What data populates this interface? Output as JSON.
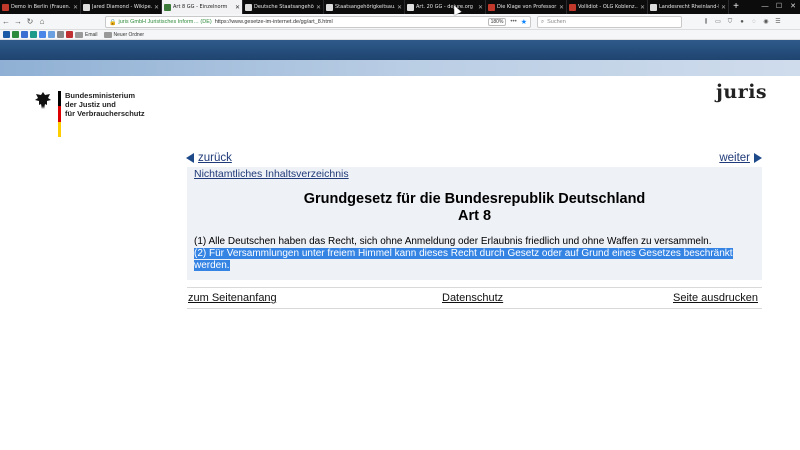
{
  "browser": {
    "tabs": [
      {
        "label": "Demo in Berlin (Frauen…",
        "active": false,
        "icon": "red-icon"
      },
      {
        "label": "Jared Diamond - Wikipe…",
        "active": false,
        "icon": "wikipedia-icon"
      },
      {
        "label": "Art 8 GG - Einzelnorm",
        "active": true,
        "icon": "juris-icon"
      },
      {
        "label": "Deutsche Staatsangehör…",
        "active": false,
        "icon": "wikipedia-icon"
      },
      {
        "label": "Staatsangehörigkeitsau…",
        "active": false,
        "icon": "wikipedia-icon"
      },
      {
        "label": "Art. 20 GG - dejure.org",
        "active": false,
        "icon": "dejure-icon"
      },
      {
        "label": "Die Klage von Professor…",
        "active": false,
        "icon": "red-icon"
      },
      {
        "label": "Vollidiot - OLG Koblenz…",
        "active": false,
        "icon": "red-icon"
      },
      {
        "label": "Landesrecht Rheinland-Pfalz…",
        "active": false,
        "icon": "page-icon"
      }
    ],
    "url_owner": "juris GmbH Juristisches Inform… (DE)",
    "url": "https://www.gesetze-im-internet.de/gg/art_8.html",
    "zoom": "180%",
    "search_placeholder": "Suchen",
    "bookmarks": [
      {
        "label": "Email"
      },
      {
        "label": "Neuer Ordner"
      }
    ]
  },
  "header": {
    "ministry_line1": "Bundesministerium",
    "ministry_line2": "der Justiz und",
    "ministry_line3": "für Verbraucherschutz",
    "juris_logo": "juris"
  },
  "nav": {
    "back": "zurück",
    "next": "weiter"
  },
  "content": {
    "toc": "Nichtamtliches Inhaltsverzeichnis",
    "law_title": "Grundgesetz für die Bundesrepublik Deutschland",
    "article_title": "Art 8",
    "paragraph1": "(1) Alle Deutschen haben das Recht, sich ohne Anmeldung oder Erlaubnis friedlich und ohne Waffen zu versammeln.",
    "paragraph2": "(2) Für Versammlungen unter freiem Himmel kann dieses Recht durch Gesetz oder auf Grund eines Gesetzes beschränkt werden."
  },
  "footer": {
    "top": "zum Seitenanfang",
    "privacy": "Datenschutz",
    "print": "Seite ausdrucken"
  },
  "colors": {
    "banner": "#2e5a8a",
    "link": "#1f3a78",
    "selection": "#3584e4"
  }
}
